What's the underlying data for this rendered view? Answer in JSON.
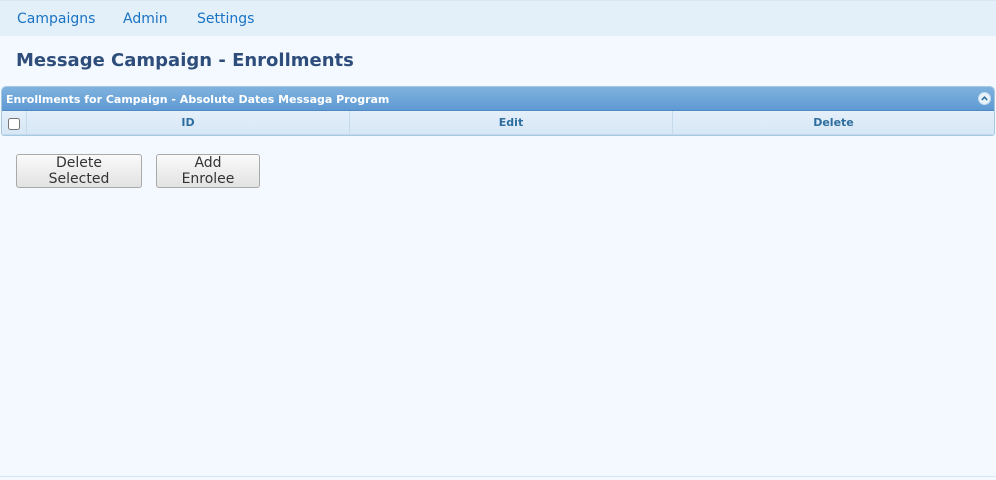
{
  "nav": {
    "items": [
      {
        "label": "Campaigns"
      },
      {
        "label": "Admin"
      },
      {
        "label": "Settings"
      }
    ]
  },
  "page": {
    "title": "Message Campaign - Enrollments"
  },
  "grid": {
    "caption": "Enrollments for Campaign - Absolute Dates Messaga Program",
    "columns": [
      "ID",
      "Edit",
      "Delete"
    ],
    "select_all_checked": false,
    "rows": []
  },
  "actions": {
    "delete_selected_label": "Delete Selected",
    "add_enrolee_label": "Add Enrolee"
  },
  "icons": {
    "collapse": "chevron-up-circle-icon"
  },
  "colors": {
    "link": "#1a73c4",
    "title": "#2e4d7b",
    "grid_caption": "#5f9ad3",
    "grid_header_text": "#2e6e9e",
    "background": "#f3f9fe"
  }
}
